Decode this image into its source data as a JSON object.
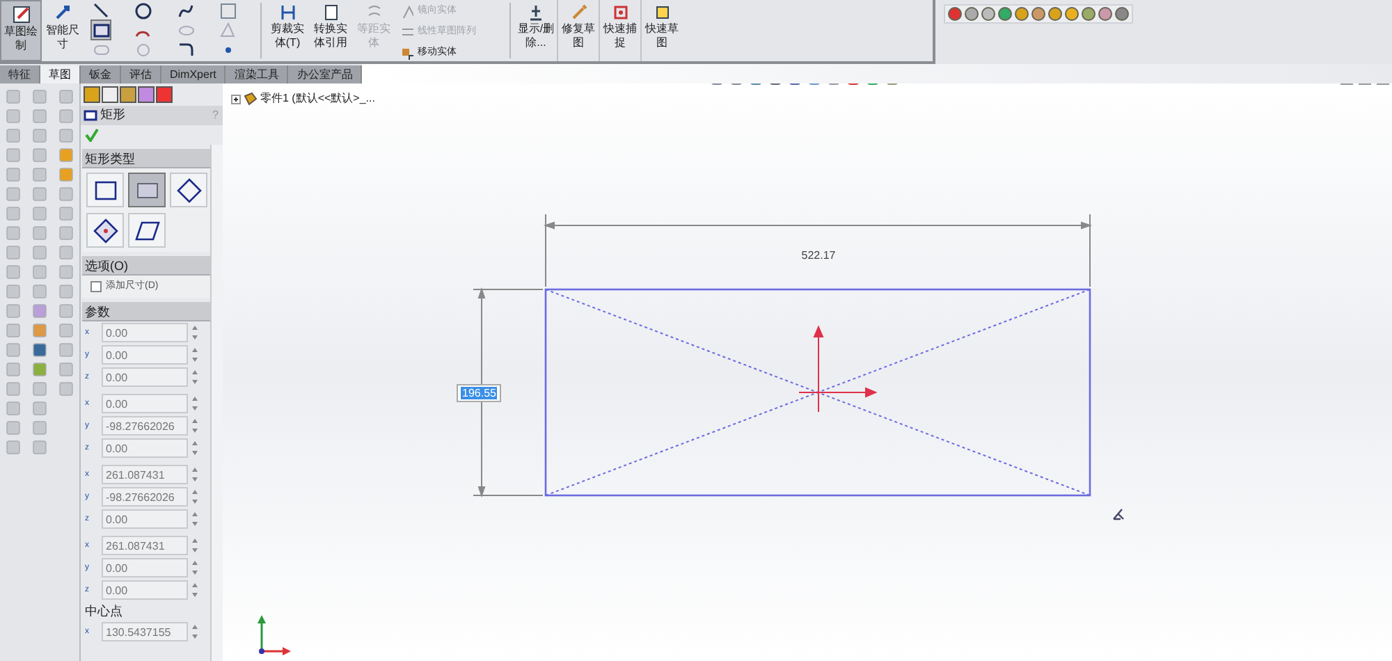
{
  "ribbon": {
    "large_buttons": [
      {
        "label": "草图绘制",
        "selected": true
      },
      {
        "label": "智能尺寸",
        "selected": false
      }
    ],
    "tool_buttons": [
      {
        "label": "剪裁实体(T)",
        "disabled": false
      },
      {
        "label": "转换实体引用",
        "disabled": false
      },
      {
        "label": "等距实体",
        "disabled": true
      }
    ],
    "small_commands": [
      {
        "label": "镜向实体",
        "disabled": true
      },
      {
        "label": "线性草图阵列",
        "disabled": true
      },
      {
        "label": "移动实体",
        "disabled": false
      }
    ],
    "more_buttons": [
      {
        "label": "显示/删除..."
      },
      {
        "label": "修复草图"
      },
      {
        "label": "快速捕捉"
      },
      {
        "label": "快速草图"
      }
    ]
  },
  "tabs": [
    {
      "label": "特征",
      "selected": false
    },
    {
      "label": "草图",
      "selected": true
    },
    {
      "label": "钣金",
      "selected": false
    },
    {
      "label": "评估",
      "selected": false
    },
    {
      "label": "DimXpert",
      "selected": false
    },
    {
      "label": "渲染工具",
      "selected": false
    },
    {
      "label": "办公室产品",
      "selected": false
    }
  ],
  "property_manager": {
    "title": "矩形",
    "help": "?",
    "rectangle_type": {
      "title": "矩形类型",
      "options": [
        {
          "selected": false
        },
        {
          "selected": true
        },
        {
          "selected": false
        },
        {
          "selected": false
        },
        {
          "selected": false
        }
      ]
    },
    "options": {
      "title": "选项(O)",
      "checkbox": {
        "label": "添加尺寸(D)",
        "checked": false
      }
    },
    "parameters": {
      "title": "参数",
      "fields": [
        {
          "axis": "x",
          "value": "0.00"
        },
        {
          "axis": "y",
          "value": "0.00"
        },
        {
          "axis": "z",
          "value": "0.00"
        },
        {
          "axis": "x",
          "value": "0.00"
        },
        {
          "axis": "y",
          "value": "-98.27662026"
        },
        {
          "axis": "z",
          "value": "0.00"
        },
        {
          "axis": "x",
          "value": "261.087431"
        },
        {
          "axis": "y",
          "value": "-98.27662026"
        },
        {
          "axis": "z",
          "value": "0.00"
        },
        {
          "axis": "x",
          "value": "261.087431"
        },
        {
          "axis": "y",
          "value": "0.00"
        },
        {
          "axis": "z",
          "value": "0.00"
        }
      ]
    },
    "center": {
      "title": "中心点",
      "fields": [
        {
          "axis": "x",
          "value": "130.5437155"
        }
      ]
    }
  },
  "canvas": {
    "tree_item": "零件1 (默认<<默认>_...",
    "width_dimension": "522.17",
    "height_dimension": "196.55"
  }
}
